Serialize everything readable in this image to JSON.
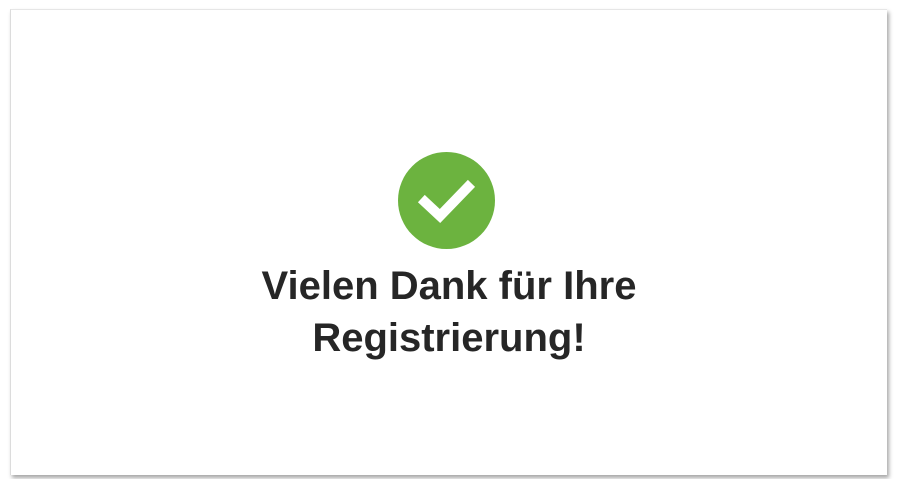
{
  "confirmation": {
    "icon": "check-circle-icon",
    "icon_color": "#6cb33f",
    "line1": "Vielen Dank für Ihre",
    "line2": "Registrierung!"
  }
}
